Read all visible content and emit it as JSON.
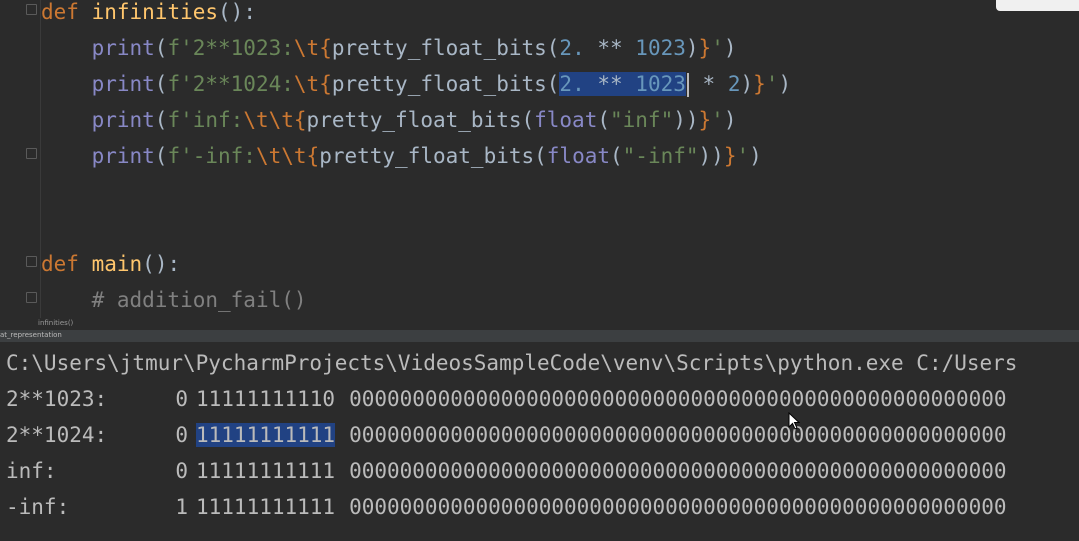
{
  "editor": {
    "lines": [
      {
        "parts": [
          {
            "t": "def",
            "c": "kw"
          },
          {
            "t": " ",
            "c": "plain"
          },
          {
            "t": "infinities",
            "c": "fn"
          },
          {
            "t": "():",
            "c": "plain"
          }
        ]
      },
      {
        "parts": [
          {
            "t": "    ",
            "c": "plain"
          },
          {
            "t": "print",
            "c": "builtin"
          },
          {
            "t": "(",
            "c": "plain"
          },
          {
            "t": "f'2**1023:",
            "c": "str"
          },
          {
            "t": "\\t",
            "c": "esc"
          },
          {
            "t": "{",
            "c": "brace"
          },
          {
            "t": "pretty_float_bits(",
            "c": "plain"
          },
          {
            "t": "2.",
            "c": "num"
          },
          {
            "t": " ** ",
            "c": "plain"
          },
          {
            "t": "1023",
            "c": "num"
          },
          {
            "t": ")",
            "c": "plain"
          },
          {
            "t": "}",
            "c": "brace"
          },
          {
            "t": "'",
            "c": "str"
          },
          {
            "t": ")",
            "c": "plain"
          }
        ]
      },
      {
        "parts": [
          {
            "t": "    ",
            "c": "plain"
          },
          {
            "t": "print",
            "c": "builtin"
          },
          {
            "t": "(",
            "c": "plain"
          },
          {
            "t": "f'2**1024:",
            "c": "str"
          },
          {
            "t": "\\t",
            "c": "esc"
          },
          {
            "t": "{",
            "c": "brace"
          },
          {
            "t": "pretty_float_bits(",
            "c": "plain"
          },
          {
            "t": "2.",
            "c": "num",
            "sel": true
          },
          {
            "t": " ** ",
            "c": "plain",
            "sel": true
          },
          {
            "t": "1023",
            "c": "num",
            "sel": true
          },
          {
            "t": "|",
            "c": "caret"
          },
          {
            "t": " * ",
            "c": "plain"
          },
          {
            "t": "2",
            "c": "num"
          },
          {
            "t": ")",
            "c": "plain"
          },
          {
            "t": "}",
            "c": "brace"
          },
          {
            "t": "'",
            "c": "str"
          },
          {
            "t": ")",
            "c": "plain"
          }
        ]
      },
      {
        "parts": [
          {
            "t": "    ",
            "c": "plain"
          },
          {
            "t": "print",
            "c": "builtin"
          },
          {
            "t": "(",
            "c": "plain"
          },
          {
            "t": "f'inf:",
            "c": "str"
          },
          {
            "t": "\\t\\t",
            "c": "esc"
          },
          {
            "t": "{",
            "c": "brace"
          },
          {
            "t": "pretty_float_bits(",
            "c": "plain"
          },
          {
            "t": "float",
            "c": "builtin"
          },
          {
            "t": "(",
            "c": "plain"
          },
          {
            "t": "\"inf\"",
            "c": "str"
          },
          {
            "t": "))",
            "c": "plain"
          },
          {
            "t": "}",
            "c": "brace"
          },
          {
            "t": "'",
            "c": "str"
          },
          {
            "t": ")",
            "c": "plain"
          }
        ]
      },
      {
        "parts": [
          {
            "t": "    ",
            "c": "plain"
          },
          {
            "t": "print",
            "c": "builtin"
          },
          {
            "t": "(",
            "c": "plain"
          },
          {
            "t": "f'-inf:",
            "c": "str"
          },
          {
            "t": "\\t\\t",
            "c": "esc"
          },
          {
            "t": "{",
            "c": "brace"
          },
          {
            "t": "pretty_float_bits(",
            "c": "plain"
          },
          {
            "t": "float",
            "c": "builtin"
          },
          {
            "t": "(",
            "c": "plain"
          },
          {
            "t": "\"-inf\"",
            "c": "str"
          },
          {
            "t": "))",
            "c": "plain"
          },
          {
            "t": "}",
            "c": "brace"
          },
          {
            "t": "'",
            "c": "str"
          },
          {
            "t": ")",
            "c": "plain"
          }
        ]
      },
      {
        "parts": []
      },
      {
        "parts": []
      },
      {
        "parts": [
          {
            "t": "def",
            "c": "kw"
          },
          {
            "t": " ",
            "c": "plain"
          },
          {
            "t": "main",
            "c": "fn"
          },
          {
            "t": "():",
            "c": "plain"
          }
        ]
      },
      {
        "parts": [
          {
            "t": "    ",
            "c": "plain"
          },
          {
            "t": "# addition_fail()",
            "c": "cmt"
          }
        ]
      }
    ]
  },
  "breadcrumb": {
    "label": "infinities()"
  },
  "run_panel": {
    "tab_label": "at_representation"
  },
  "console": {
    "command": "C:\\Users\\jtmur\\PycharmProjects\\VideosSampleCode\\venv\\Scripts\\python.exe C:/Users",
    "rows": [
      {
        "label": "2**1023:",
        "sign": "0",
        "exponent": "11111111110",
        "mantissa": "0000000000000000000000000000000000000000000000000000",
        "highlight": false
      },
      {
        "label": "2**1024:",
        "sign": "0",
        "exponent": "11111111111",
        "mantissa": "0000000000000000000000000000000000000000000000000000",
        "highlight": true
      },
      {
        "label": "inf:",
        "sign": "0",
        "exponent": "11111111111",
        "mantissa": "0000000000000000000000000000000000000000000000000000",
        "highlight": false
      },
      {
        "label": "-inf:",
        "sign": "1",
        "exponent": "11111111111",
        "mantissa": "0000000000000000000000000000000000000000000000000000",
        "highlight": false
      }
    ]
  },
  "colors": {
    "editor_bg": "#2b2b2b",
    "keyword": "#cc7832",
    "function": "#ffc66d",
    "builtin": "#8888c6",
    "string": "#6a8759",
    "number": "#6897bb",
    "comment": "#808080",
    "selection": "#214283",
    "console_text": "#bbbbbb"
  }
}
